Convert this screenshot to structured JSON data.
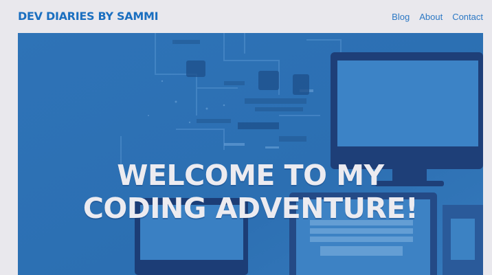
{
  "header": {
    "brand": "DEV DIARIES BY SAMMI",
    "nav": [
      "Blog",
      "About",
      "Contact"
    ]
  },
  "hero": {
    "title_line1": "WELCOME TO MY",
    "title_line2": "CODING ADVENTURE!",
    "image": "computers-illustration"
  },
  "colors": {
    "page_bg": "#e9e8ed",
    "brand": "#1b6fc0",
    "nav_link": "#2c78c4",
    "hero_bg": "#2f74b6",
    "hero_text": "#ecebf0"
  }
}
